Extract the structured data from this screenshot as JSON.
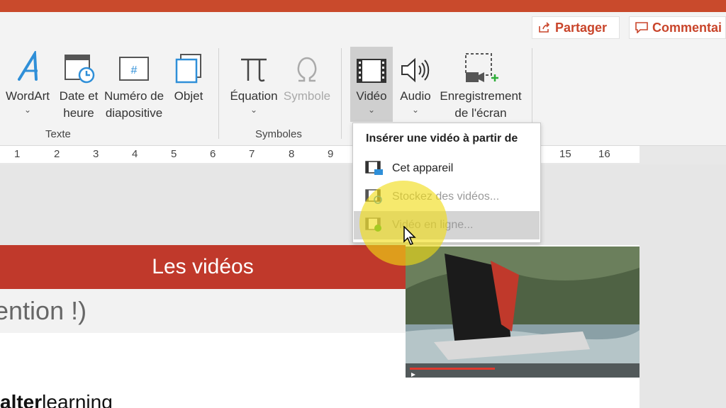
{
  "header": {
    "share_label": "Partager",
    "comment_label": "Commentai"
  },
  "ribbon": {
    "text_group": {
      "label": "Texte",
      "wordart": "WordArt",
      "date_line1": "Date et",
      "date_line2": "heure",
      "slide_number_line1": "Numéro de",
      "slide_number_line2": "diapositive",
      "object": "Objet"
    },
    "symbols_group": {
      "label": "Symboles",
      "equation": "Équation",
      "symbol": "Symbole"
    },
    "media": {
      "video": "Vidéo",
      "audio": "Audio",
      "screen_record_line1": "Enregistrement",
      "screen_record_line2": "de l'écran"
    }
  },
  "ruler": {
    "ticks": [
      "1",
      "2",
      "3",
      "4",
      "5",
      "6",
      "7",
      "8",
      "9",
      "15",
      "16"
    ]
  },
  "dropdown": {
    "title": "Insérer une vidéo à partir de",
    "items": [
      {
        "label": "Cet appareil"
      },
      {
        "label": "Stockez des vidéos..."
      },
      {
        "label": "Vidéo en ligne..."
      }
    ]
  },
  "slide": {
    "title": "Les vidéos",
    "subtitle": "ention !)"
  },
  "watermark": {
    "bold": "alter",
    "rest": "learning"
  },
  "colors": {
    "accent": "#c94a2c",
    "slide_header": "#c0392b",
    "highlight": "#f0dc14"
  }
}
